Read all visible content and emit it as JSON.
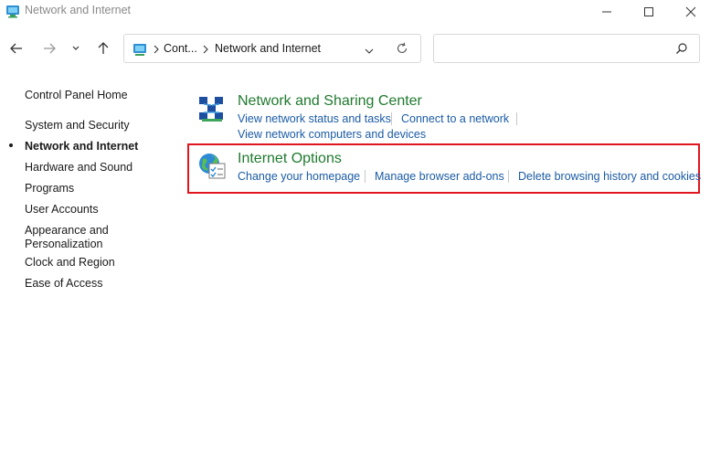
{
  "window": {
    "title": "Network and Internet"
  },
  "address_bar": {
    "crumbs": [
      "Cont...",
      "Network and Internet"
    ]
  },
  "search": {
    "placeholder": ""
  },
  "sidebar": {
    "home": "Control Panel Home",
    "items": [
      {
        "label": "System and Security",
        "active": false
      },
      {
        "label": "Network and Internet",
        "active": true
      },
      {
        "label": "Hardware and Sound",
        "active": false
      },
      {
        "label": "Programs",
        "active": false
      },
      {
        "label": "User Accounts",
        "active": false
      },
      {
        "label": "Appearance and Personalization",
        "active": false
      },
      {
        "label": "Clock and Region",
        "active": false
      },
      {
        "label": "Ease of Access",
        "active": false
      }
    ]
  },
  "categories": [
    {
      "title": "Network and Sharing Center",
      "icon": "network-sharing-icon",
      "links": [
        "View network status and tasks",
        "Connect to a network",
        "View network computers and devices"
      ]
    },
    {
      "title": "Internet Options",
      "icon": "internet-options-icon",
      "highlighted": true,
      "links": [
        "Change your homepage",
        "Manage browser add-ons",
        "Delete browsing history and cookies"
      ]
    }
  ],
  "colors": {
    "category_title": "#1f7a2e",
    "link": "#1a5ba6",
    "highlight": "#e0151d"
  }
}
